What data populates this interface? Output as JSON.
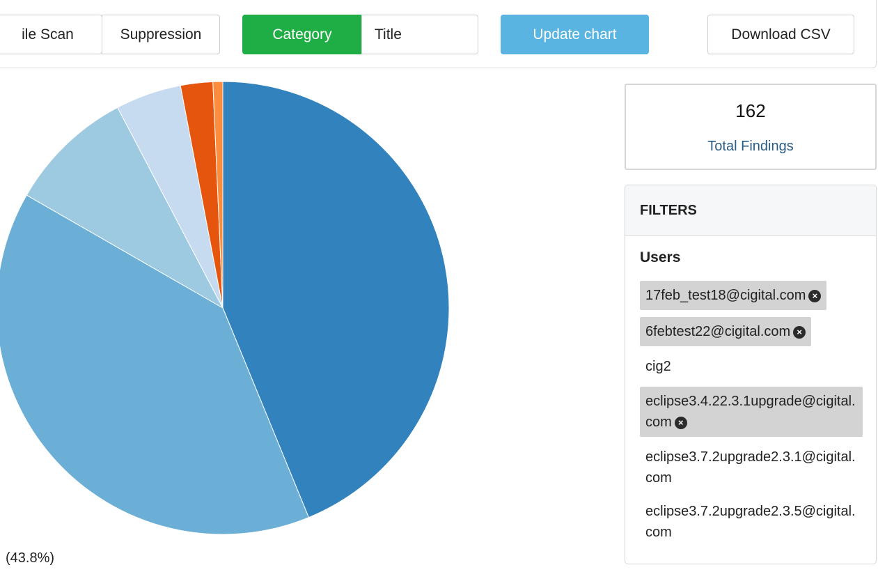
{
  "toolbar": {
    "buttons": {
      "file_scan": "ile Scan",
      "suppression": "Suppression",
      "category": "Category",
      "title": "Title",
      "update_chart": "Update chart",
      "download_csv": "Download CSV"
    },
    "active_toggle_color": "#1fae45",
    "update_color": "#5ab4e2"
  },
  "chart_data": {
    "type": "pie",
    "values": [
      43.8,
      39.5,
      9.0,
      4.7,
      2.3,
      0.7
    ],
    "colors": [
      "#3182bd",
      "#6baed6",
      "#9ecae1",
      "#c6dbef",
      "#e6550d",
      "#fd8d3c"
    ],
    "visible_label": "(43.8%)"
  },
  "summary": {
    "count": "162",
    "label": "Total Findings"
  },
  "filters": {
    "header": "FILTERS",
    "users_heading": "Users",
    "users": [
      {
        "name": "17feb_test18@cigital.com",
        "selected": true
      },
      {
        "name": "6febtest22@cigital.com",
        "selected": true
      },
      {
        "name": "cig2",
        "selected": false
      },
      {
        "name": "eclipse3.4.22.3.1upgrade@cigital.com",
        "selected": true
      },
      {
        "name": "eclipse3.7.2upgrade2.3.1@cigital.com",
        "selected": false
      },
      {
        "name": "eclipse3.7.2upgrade2.3.5@cigital.com",
        "selected": false
      }
    ]
  }
}
